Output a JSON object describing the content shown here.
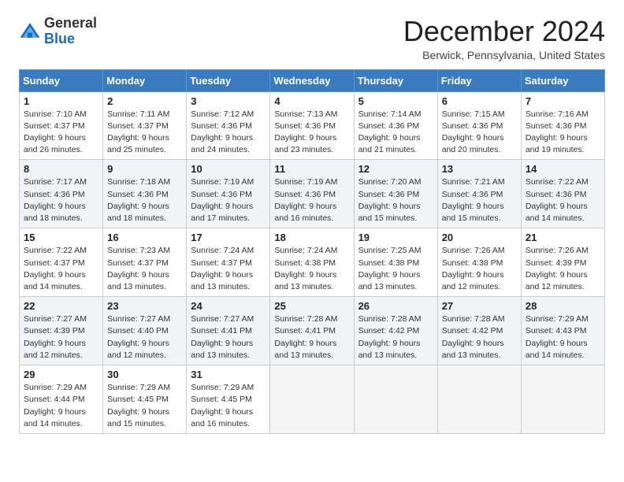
{
  "header": {
    "logo_general": "General",
    "logo_blue": "Blue",
    "month_title": "December 2024",
    "location": "Berwick, Pennsylvania, United States"
  },
  "weekdays": [
    "Sunday",
    "Monday",
    "Tuesday",
    "Wednesday",
    "Thursday",
    "Friday",
    "Saturday"
  ],
  "weeks": [
    [
      {
        "day": "1",
        "info": "Sunrise: 7:10 AM\nSunset: 4:37 PM\nDaylight: 9 hours and 26 minutes."
      },
      {
        "day": "2",
        "info": "Sunrise: 7:11 AM\nSunset: 4:37 PM\nDaylight: 9 hours and 25 minutes."
      },
      {
        "day": "3",
        "info": "Sunrise: 7:12 AM\nSunset: 4:36 PM\nDaylight: 9 hours and 24 minutes."
      },
      {
        "day": "4",
        "info": "Sunrise: 7:13 AM\nSunset: 4:36 PM\nDaylight: 9 hours and 23 minutes."
      },
      {
        "day": "5",
        "info": "Sunrise: 7:14 AM\nSunset: 4:36 PM\nDaylight: 9 hours and 21 minutes."
      },
      {
        "day": "6",
        "info": "Sunrise: 7:15 AM\nSunset: 4:36 PM\nDaylight: 9 hours and 20 minutes."
      },
      {
        "day": "7",
        "info": "Sunrise: 7:16 AM\nSunset: 4:36 PM\nDaylight: 9 hours and 19 minutes."
      }
    ],
    [
      {
        "day": "8",
        "info": "Sunrise: 7:17 AM\nSunset: 4:36 PM\nDaylight: 9 hours and 18 minutes."
      },
      {
        "day": "9",
        "info": "Sunrise: 7:18 AM\nSunset: 4:36 PM\nDaylight: 9 hours and 18 minutes."
      },
      {
        "day": "10",
        "info": "Sunrise: 7:19 AM\nSunset: 4:36 PM\nDaylight: 9 hours and 17 minutes."
      },
      {
        "day": "11",
        "info": "Sunrise: 7:19 AM\nSunset: 4:36 PM\nDaylight: 9 hours and 16 minutes."
      },
      {
        "day": "12",
        "info": "Sunrise: 7:20 AM\nSunset: 4:36 PM\nDaylight: 9 hours and 15 minutes."
      },
      {
        "day": "13",
        "info": "Sunrise: 7:21 AM\nSunset: 4:36 PM\nDaylight: 9 hours and 15 minutes."
      },
      {
        "day": "14",
        "info": "Sunrise: 7:22 AM\nSunset: 4:36 PM\nDaylight: 9 hours and 14 minutes."
      }
    ],
    [
      {
        "day": "15",
        "info": "Sunrise: 7:22 AM\nSunset: 4:37 PM\nDaylight: 9 hours and 14 minutes."
      },
      {
        "day": "16",
        "info": "Sunrise: 7:23 AM\nSunset: 4:37 PM\nDaylight: 9 hours and 13 minutes."
      },
      {
        "day": "17",
        "info": "Sunrise: 7:24 AM\nSunset: 4:37 PM\nDaylight: 9 hours and 13 minutes."
      },
      {
        "day": "18",
        "info": "Sunrise: 7:24 AM\nSunset: 4:38 PM\nDaylight: 9 hours and 13 minutes."
      },
      {
        "day": "19",
        "info": "Sunrise: 7:25 AM\nSunset: 4:38 PM\nDaylight: 9 hours and 13 minutes."
      },
      {
        "day": "20",
        "info": "Sunrise: 7:26 AM\nSunset: 4:38 PM\nDaylight: 9 hours and 12 minutes."
      },
      {
        "day": "21",
        "info": "Sunrise: 7:26 AM\nSunset: 4:39 PM\nDaylight: 9 hours and 12 minutes."
      }
    ],
    [
      {
        "day": "22",
        "info": "Sunrise: 7:27 AM\nSunset: 4:39 PM\nDaylight: 9 hours and 12 minutes."
      },
      {
        "day": "23",
        "info": "Sunrise: 7:27 AM\nSunset: 4:40 PM\nDaylight: 9 hours and 12 minutes."
      },
      {
        "day": "24",
        "info": "Sunrise: 7:27 AM\nSunset: 4:41 PM\nDaylight: 9 hours and 13 minutes."
      },
      {
        "day": "25",
        "info": "Sunrise: 7:28 AM\nSunset: 4:41 PM\nDaylight: 9 hours and 13 minutes."
      },
      {
        "day": "26",
        "info": "Sunrise: 7:28 AM\nSunset: 4:42 PM\nDaylight: 9 hours and 13 minutes."
      },
      {
        "day": "27",
        "info": "Sunrise: 7:28 AM\nSunset: 4:42 PM\nDaylight: 9 hours and 13 minutes."
      },
      {
        "day": "28",
        "info": "Sunrise: 7:29 AM\nSunset: 4:43 PM\nDaylight: 9 hours and 14 minutes."
      }
    ],
    [
      {
        "day": "29",
        "info": "Sunrise: 7:29 AM\nSunset: 4:44 PM\nDaylight: 9 hours and 14 minutes."
      },
      {
        "day": "30",
        "info": "Sunrise: 7:29 AM\nSunset: 4:45 PM\nDaylight: 9 hours and 15 minutes."
      },
      {
        "day": "31",
        "info": "Sunrise: 7:29 AM\nSunset: 4:45 PM\nDaylight: 9 hours and 16 minutes."
      },
      null,
      null,
      null,
      null
    ]
  ]
}
